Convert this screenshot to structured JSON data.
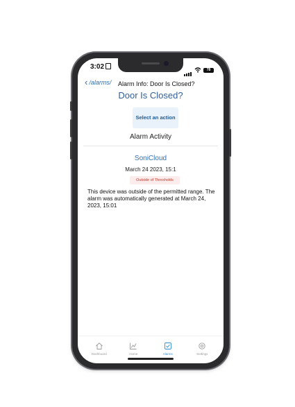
{
  "status": {
    "time": "3:02",
    "battery": "78"
  },
  "nav": {
    "back_label": "/alarms/",
    "title": "Alarm Info: Door Is Closed?"
  },
  "alarm": {
    "heading": "Door Is Closed?",
    "action_button": "Select an action",
    "section_title": "Alarm Activity",
    "source": "SoniCloud",
    "date": "March 24 2023, 15:1",
    "badge": "Outside of Thresholds",
    "message": "This device was outside of the permitted range. The alarm was automatically generated at March 24, 2023, 15:01"
  },
  "tabs": [
    {
      "label": "Dashboard",
      "icon": "home-icon"
    },
    {
      "label": "Home",
      "icon": "chart-icon"
    },
    {
      "label": "Alarms",
      "icon": "alarm-icon",
      "active": true
    },
    {
      "label": "Settings",
      "icon": "gear-icon"
    }
  ],
  "colors": {
    "accent": "#2f6fb3",
    "active_tab": "#2f8fd6",
    "badge_text": "#c0392b",
    "badge_bg": "#fdecec"
  }
}
